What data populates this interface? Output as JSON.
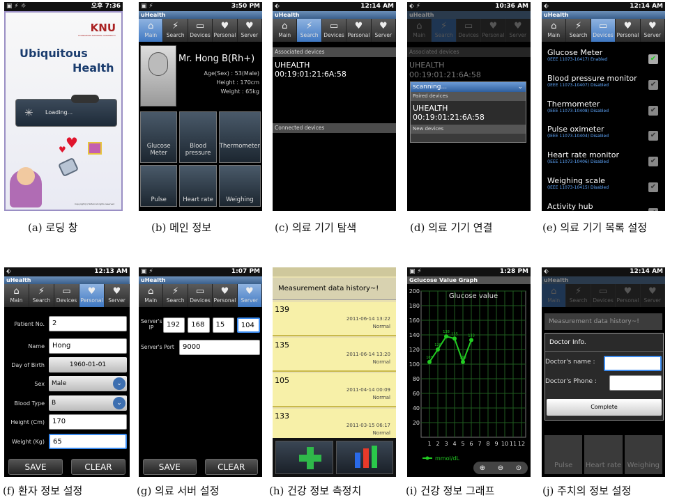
{
  "status": {
    "a": "오후 7:36",
    "b": "3:50 PM",
    "c": "12:14 AM",
    "d": "10:36 AM",
    "e": "12:14 AM",
    "f": "12:13 AM",
    "g": "1:07 PM",
    "i": "1:28 PM",
    "j": "12:14 AM"
  },
  "app_title": "uHealth",
  "tabs": [
    "Main",
    "Search",
    "Devices",
    "Personal",
    "Server"
  ],
  "loading": {
    "logo": "KNU",
    "logo_sub": "KYUNGPOOK NATIONAL UNIVERSITY",
    "title1": "Ubiquitous",
    "title2": "Health",
    "msg": "Loading...",
    "copyright": "Copyright(c) TeHeli All rights reserved"
  },
  "main": {
    "name": "Mr. Hong  B(Rh+)",
    "age": "Age(Sex) : 53(Male)",
    "height": "Height : 170cm",
    "weight": "Weight : 65kg",
    "tiles": [
      "Glucose Meter",
      "Blood pressure",
      "Thermometer",
      "Pulse",
      "Heart rate",
      "Weighing"
    ]
  },
  "search": {
    "assoc": "Associated devices",
    "dev_name": "UHEALTH",
    "dev_mac": "00:19:01:21:6A:58",
    "connected": "Connected devices"
  },
  "connect": {
    "scanning": "scanning...",
    "paired": "Paired devices",
    "new": "New devices"
  },
  "devices": [
    {
      "name": "Glucose Meter",
      "sub": "(IEEE 11073-10417) Enabled",
      "on": true
    },
    {
      "name": "Blood pressure monitor",
      "sub": "(IEEE 11073-10407) Disabled",
      "on": false
    },
    {
      "name": "Thermometer",
      "sub": "(IEEE 11073-10408) Disabled",
      "on": false
    },
    {
      "name": "Pulse oximeter",
      "sub": "(IEEE 11073-10404) Disabled",
      "on": false
    },
    {
      "name": "Heart rate monitor",
      "sub": "(IEEE 11073-10406) Disabled",
      "on": false
    },
    {
      "name": "Weighing scale",
      "sub": "(IEEE 11073-10415) Disabled",
      "on": false
    },
    {
      "name": "Activity hub",
      "sub": "",
      "on": false
    }
  ],
  "personal": {
    "labels": [
      "Patient No.",
      "Name",
      "Day of Birth",
      "Sex",
      "Blood Type",
      "Height (Cm)",
      "Weight (Kg)"
    ],
    "values": [
      "2",
      "Hong",
      "1960-01-01",
      "Male",
      "B",
      "170",
      "65"
    ]
  },
  "buttons": {
    "save": "SAVE",
    "clear": "CLEAR"
  },
  "server": {
    "ip_label": "Server's IP",
    "ip": [
      "192",
      "168",
      "15",
      "104"
    ],
    "port_label": "Server's Port",
    "port": "9000"
  },
  "history": {
    "title": "Measurement data history~!",
    "rows": [
      {
        "v": "139",
        "d": "2011-06-14   13:22",
        "s": "Normal"
      },
      {
        "v": "135",
        "d": "2011-06-14   13:20",
        "s": "Normal"
      },
      {
        "v": "105",
        "d": "2011-04-14   00:09",
        "s": "Normal"
      },
      {
        "v": "133",
        "d": "2011-03-15   06:17",
        "s": "Normal"
      }
    ]
  },
  "graph": {
    "title": "Gclucose Value Graph"
  },
  "chart_data": {
    "type": "line",
    "title": "Glucose value",
    "x": [
      1,
      2,
      3,
      4,
      5,
      6
    ],
    "series": [
      {
        "name": "mmol/dL",
        "values": [
          103,
          120,
          138,
          135,
          103,
          133
        ]
      }
    ],
    "xticks": [
      1,
      2,
      3,
      4,
      5,
      6,
      7,
      8,
      9,
      10,
      11,
      12
    ],
    "yticks": [
      20,
      40,
      60,
      80,
      100,
      120,
      140,
      160,
      180,
      200
    ],
    "ylim": [
      0,
      200
    ],
    "xlim": [
      0,
      12.5
    ],
    "color": "#22cc22",
    "grid": true
  },
  "doctor": {
    "title": "Doctor Info.",
    "name_label": "Doctor's name :",
    "phone_label": "Doctor's Phone :",
    "complete": "Complete",
    "bg_title": "Measurement data history~!",
    "bottom": [
      "Pulse",
      "Heart rate",
      "Weighing"
    ]
  },
  "captions": [
    "(a) 로딩 창",
    "(b) 메인 정보",
    "(c) 의료 기기 탐색",
    "(d) 의료 기기 연결",
    "(e) 의료 기기 목록 설정",
    "(f) 환자 정보 설정",
    "(g) 의료 서버 설정",
    "(h) 건강 정보 측정치",
    "(i) 건강 정보 그래프",
    "(j) 주치의 정보 설정"
  ]
}
